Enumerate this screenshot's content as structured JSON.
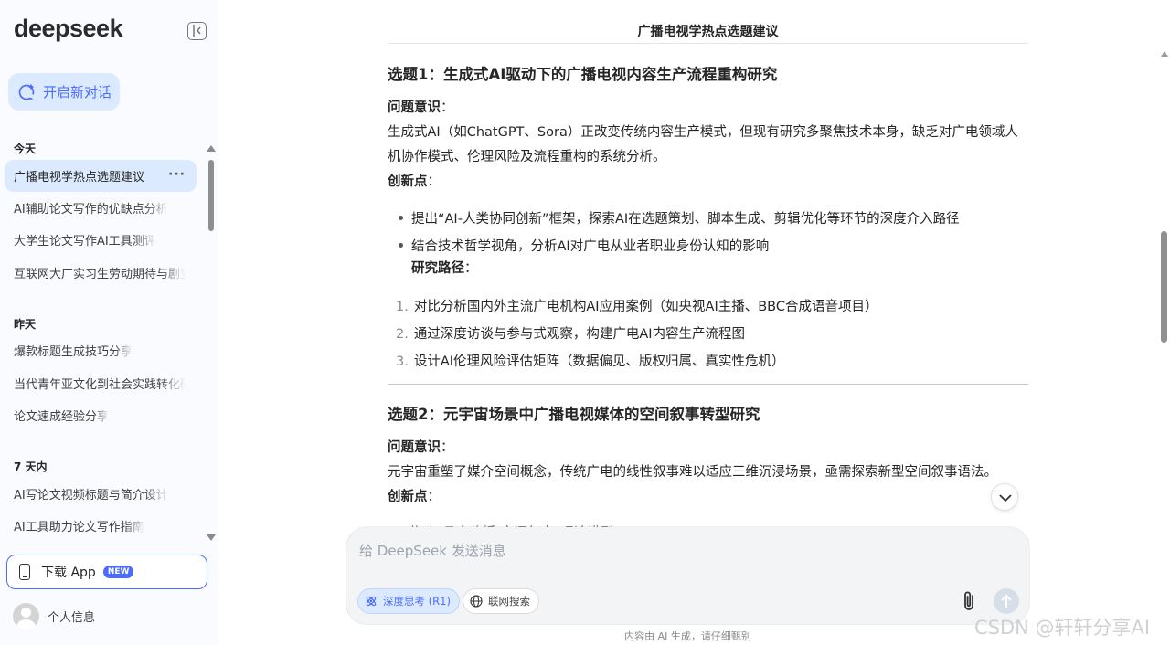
{
  "sidebar": {
    "logo": "deepseek",
    "new_chat_label": "开启新对话",
    "groups": [
      {
        "title": "今天"
      },
      {
        "title": "昨天"
      },
      {
        "title": "7 天内"
      }
    ],
    "items": [
      {
        "label": "广播电视学热点选题建议"
      },
      {
        "label": "AI辅助论文写作的优缺点分析"
      },
      {
        "label": "大学生论文写作AI工具测评"
      },
      {
        "label": "互联网大厂实习生劳动期待与剧变"
      },
      {
        "label": "爆款标题生成技巧分享"
      },
      {
        "label": "当代青年亚文化到社会实践转化研究"
      },
      {
        "label": "论文速成经验分享"
      },
      {
        "label": "AI写论文视频标题与简介设计"
      },
      {
        "label": "AI工具助力论文写作指南"
      }
    ],
    "more_glyph": "···",
    "download_label": "下载 App",
    "new_badge": "NEW",
    "profile_label": "个人信息"
  },
  "conversation": {
    "title": "广播电视学热点选题建议",
    "topic1": {
      "heading": "选题1：生成式AI驱动下的广播电视内容生产流程重构研究",
      "problem_label": "问题意识",
      "colon": "：",
      "problem_text": "生成式AI（如ChatGPT、Sora）正改变传统内容生产模式，但现有研究多聚焦技术本身，缺乏对广电领域人机协作模式、伦理风险及流程重构的系统分析。",
      "innovation_label": "创新点",
      "innovations": [
        "提出“AI-人类协同创新”框架，探索AI在选题策划、脚本生成、剪辑优化等环节的深度介入路径",
        "结合技术哲学视角，分析AI对广电从业者职业身份认知的影响"
      ],
      "path_label": "研究路径",
      "paths": [
        {
          "n": "1.",
          "text": "对比分析国内外主流广电机构AI应用案例（如央视AI主播、BBC合成语音项目）"
        },
        {
          "n": "2.",
          "text": "通过深度访谈与参与式观察，构建广电AI内容生产流程图"
        },
        {
          "n": "3.",
          "text": "设计AI伦理风险评估矩阵（数据偏见、版权归属、真实性危机）"
        }
      ]
    },
    "topic2": {
      "heading": "选题2：元宇宙场景中广播电视媒体的空间叙事转型研究",
      "problem_label": "问题意识",
      "problem_text": "元宇宙重塑了媒介空间概念，传统广电的线性叙事难以适应三维沉浸场景，亟需探索新型空间叙事语法。",
      "innovation_label": "创新点",
      "partial_line": "构建“具身传播-空间叙事”理论模型"
    }
  },
  "composer": {
    "placeholder": "给 DeepSeek 发送消息",
    "deep_think_label": "深度思考 (R1)",
    "web_search_label": "联网搜索"
  },
  "footer_note": "内容由 AI 生成，请仔细甄别",
  "watermark": "CSDN @轩轩分享AI",
  "colors": {
    "accent": "#4d6bfe",
    "active_bg": "#dbeafe",
    "sidebar_bg": "#f9fbff"
  }
}
